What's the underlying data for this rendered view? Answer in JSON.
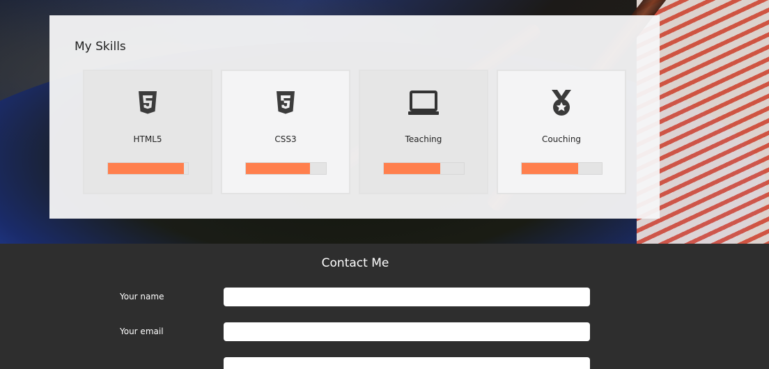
{
  "skills": {
    "title": "My Skills",
    "items": [
      {
        "label": "HTML5",
        "icon": "html5-icon",
        "level": 0.95
      },
      {
        "label": "CSS3",
        "icon": "css3-icon",
        "level": 0.8
      },
      {
        "label": "Teaching",
        "icon": "laptop-icon",
        "level": 0.7
      },
      {
        "label": "Couching",
        "icon": "medal-icon",
        "level": 0.7
      }
    ]
  },
  "contact": {
    "title": "Contact Me",
    "fields": [
      {
        "label": "Your name",
        "value": "",
        "placeholder": ""
      },
      {
        "label": "Your email",
        "value": "",
        "placeholder": ""
      },
      {
        "label": "",
        "value": "",
        "placeholder": ""
      }
    ]
  },
  "colors": {
    "accent": "#ff7f4d",
    "panel": "#f6f6f7",
    "footer": "#2e2e2e"
  }
}
